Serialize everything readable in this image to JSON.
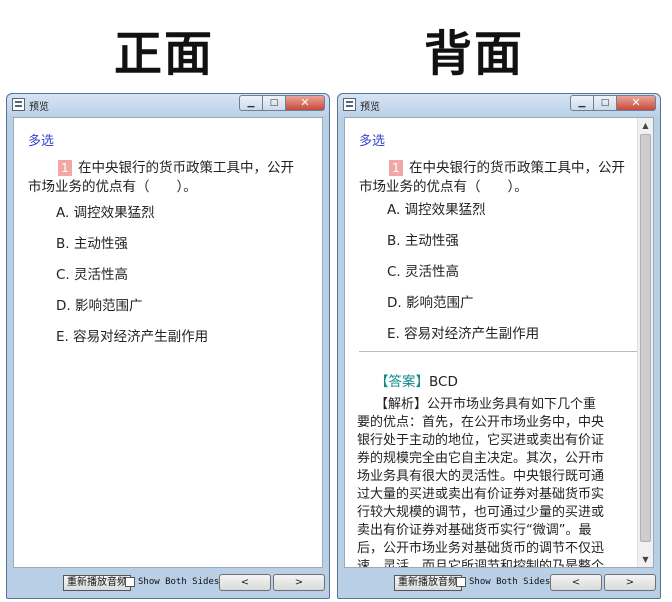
{
  "headings": {
    "front": "正面",
    "back": "背面"
  },
  "window": {
    "title": "预览",
    "controls": {
      "minimize": "▁",
      "maximize": "□",
      "close": "✕"
    }
  },
  "question": {
    "type": "多选",
    "number": "1",
    "line1": "在中央银行的货币政策工具中，公开",
    "line2": "市场业务的优点有（　　）。",
    "options": [
      {
        "label": "A.",
        "text": "调控效果猛烈"
      },
      {
        "label": "B.",
        "text": "主动性强"
      },
      {
        "label": "C.",
        "text": "灵活性高"
      },
      {
        "label": "D.",
        "text": "影响范围广"
      },
      {
        "label": "E.",
        "text": "容易对经济产生副作用"
      }
    ]
  },
  "answer": {
    "tag": "【答案】",
    "value": "BCD"
  },
  "explanation": {
    "tag": "【解析】",
    "lines": [
      "公开市场业务具有如下几个重",
      "要的优点：首先，在公开市场业务中，中央",
      "银行处于主动的地位，它买进或卖出有价证",
      "券的规模完全由它自主决定。其次，公开市",
      "场业务具有很大的灵活性。中央银行既可通",
      "过大量的买进或卖出有价证券对基础货币实",
      "行较大规模的调节，也可通过少量的买进或",
      "卖出有价证券对基础货币实行“微调”。最",
      "后，公开市场业务对基础货币的调节不仅迅",
      "速、灵活，而且它所调节和控制的乃是整个"
    ]
  },
  "footer": {
    "replay_label": "重新播放音频",
    "show_both_label": "Show Both Sides",
    "prev_label": "<",
    "next_label": ">"
  },
  "scrollbar": {
    "up": "▲",
    "down": "▼"
  }
}
